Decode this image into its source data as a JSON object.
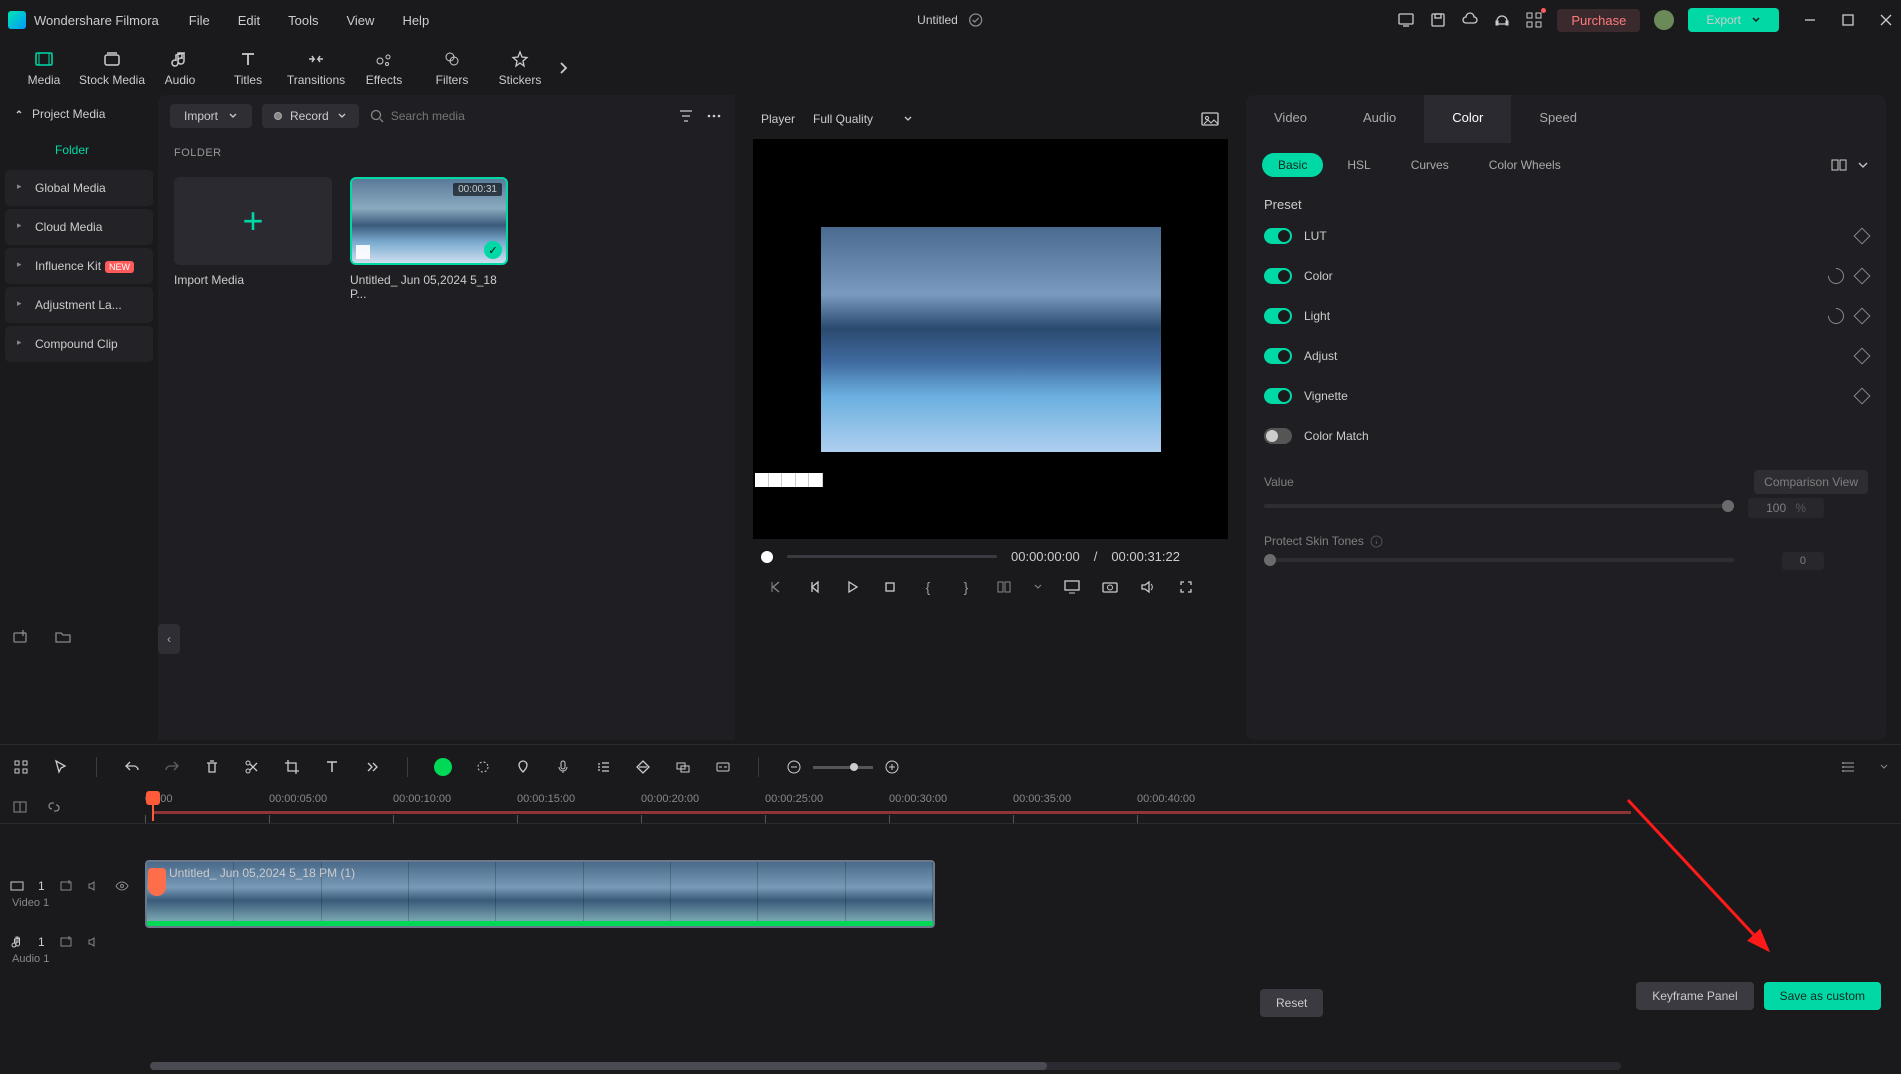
{
  "app": {
    "title": "Wondershare Filmora",
    "document": "Untitled"
  },
  "menu": [
    "File",
    "Edit",
    "Tools",
    "View",
    "Help"
  ],
  "titlebar": {
    "purchase": "Purchase",
    "export": "Export"
  },
  "toolbar": [
    {
      "label": "Media",
      "active": true
    },
    {
      "label": "Stock Media"
    },
    {
      "label": "Audio"
    },
    {
      "label": "Titles"
    },
    {
      "label": "Transitions"
    },
    {
      "label": "Effects"
    },
    {
      "label": "Filters"
    },
    {
      "label": "Stickers"
    }
  ],
  "sidebar": {
    "project_media": "Project Media",
    "folder": "Folder",
    "items": [
      {
        "label": "Global Media"
      },
      {
        "label": "Cloud Media"
      },
      {
        "label": "Influence Kit",
        "badge": "NEW"
      },
      {
        "label": "Adjustment La..."
      },
      {
        "label": "Compound Clip"
      }
    ]
  },
  "media": {
    "import": "Import",
    "record": "Record",
    "search_placeholder": "Search media",
    "folder_header": "FOLDER",
    "import_media": "Import Media",
    "clip_name": "Untitled_ Jun 05,2024 5_18 P...",
    "clip_duration": "00:00:31"
  },
  "player": {
    "label": "Player",
    "quality": "Full Quality",
    "time_current": "00:00:00:00",
    "time_sep": "/",
    "time_total": "00:00:31:22"
  },
  "inspector": {
    "tabs": [
      "Video",
      "Audio",
      "Color",
      "Speed"
    ],
    "active_tab": "Color",
    "subtabs": [
      "Basic",
      "HSL",
      "Curves",
      "Color Wheels"
    ],
    "active_subtab": "Basic",
    "preset": "Preset",
    "rows": [
      {
        "label": "LUT",
        "reset": false
      },
      {
        "label": "Color",
        "reset": true
      },
      {
        "label": "Light",
        "reset": true
      },
      {
        "label": "Adjust",
        "reset": false
      },
      {
        "label": "Vignette",
        "reset": false
      }
    ],
    "color_match": "Color Match",
    "value": "Value",
    "comparison_view": "Comparison View",
    "value_num": "100",
    "value_unit": "%",
    "protect_skin": "Protect Skin Tones",
    "protect_val": "0",
    "reset": "Reset",
    "keyframe_panel": "Keyframe Panel",
    "save_custom": "Save as custom"
  },
  "timeline": {
    "ticks": [
      "00:00",
      "00:00:05:00",
      "00:00:10:00",
      "00:00:15:00",
      "00:00:20:00",
      "00:00:25:00",
      "00:00:30:00",
      "00:00:35:00",
      "00:00:40:00"
    ],
    "video_track": "Video 1",
    "video_index": "1",
    "audio_track": "Audio 1",
    "audio_index": "1",
    "clip_label": "Untitled_ Jun 05,2024 5_18 PM (1)"
  }
}
